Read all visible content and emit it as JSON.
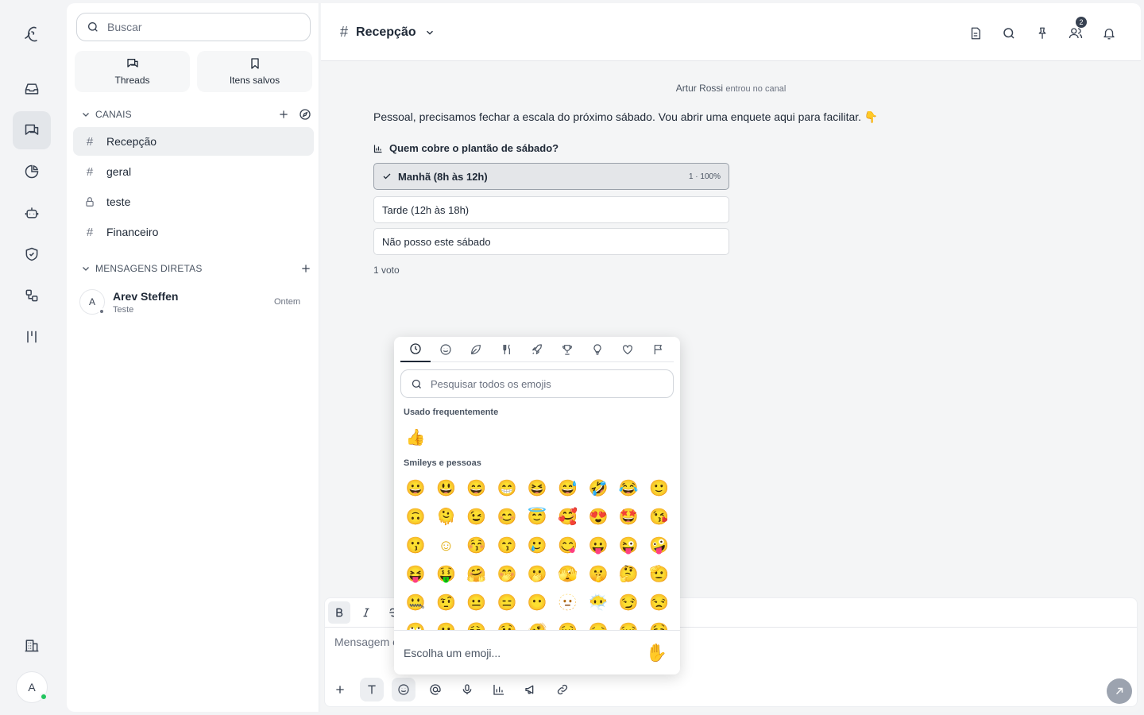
{
  "rail": {
    "items": [
      "logo-icon",
      "inbox-icon",
      "chats-icon",
      "pie-chart-icon",
      "bot-icon",
      "shield-icon",
      "integrations-icon",
      "kanban-icon",
      "building-icon"
    ],
    "user_initial": "A"
  },
  "sidebar": {
    "search_placeholder": "Buscar",
    "threads_label": "Threads",
    "saved_label": "Itens salvos",
    "channels_header": "CANAIS",
    "channels": [
      {
        "name": "Recepção",
        "icon": "hash-icon",
        "active": true
      },
      {
        "name": "geral",
        "icon": "hash-icon"
      },
      {
        "name": "teste",
        "icon": "lock-icon"
      },
      {
        "name": "Financeiro",
        "icon": "hash-icon"
      }
    ],
    "dm_header": "MENSAGENS DIRETAS",
    "dms": [
      {
        "initial": "A",
        "name": "Arev Steffen",
        "preview": "Teste",
        "time": "Ontem"
      }
    ]
  },
  "header": {
    "channel_name": "Recepção",
    "members_badge": "2"
  },
  "feed": {
    "system_user": "Artur Rossi",
    "system_text": "entrou no canal",
    "message": "Pessoal, precisamos fechar a escala do próximo sábado. Vou abrir uma enquete aqui para facilitar. 👇",
    "poll": {
      "question": "Quem cobre o plantão de sábado?",
      "options": [
        {
          "label": "Manhã (8h às 12h)",
          "result": "1 · 100%",
          "selected": true
        },
        {
          "label": "Tarde (12h às 18h)",
          "result": ""
        },
        {
          "label": "Não posso este sábado",
          "result": ""
        }
      ],
      "votes": "1 voto"
    }
  },
  "composer": {
    "placeholder": "Mensagem e"
  },
  "emoji_picker": {
    "search_placeholder": "Pesquisar todos os emojis",
    "frequent_label": "Usado frequentemente",
    "frequent": [
      "👍"
    ],
    "smileys_label": "Smileys e pessoas",
    "smileys": [
      "😀",
      "😃",
      "😄",
      "😁",
      "😆",
      "😅",
      "🤣",
      "😂",
      "🙂",
      "🙃",
      "🫠",
      "😉",
      "😊",
      "😇",
      "🥰",
      "😍",
      "🤩",
      "😘",
      "😗",
      "☺",
      "😚",
      "😙",
      "🥲",
      "😋",
      "😛",
      "😜",
      "🤪",
      "😝",
      "🤑",
      "🤗",
      "🤭",
      "🫢",
      "🫣",
      "🤫",
      "🤔",
      "🫡",
      "🤐",
      "🤨",
      "😐",
      "😑",
      "😶",
      "🫥",
      "😶‍🌫️",
      "😏",
      "😒",
      "🙄",
      "😬",
      "😮‍💨",
      "🤥",
      "🫨",
      "😌",
      "😔",
      "😪",
      "🤤"
    ],
    "footer_text": "Escolha um emoji...",
    "footer_emoji": "✋"
  }
}
